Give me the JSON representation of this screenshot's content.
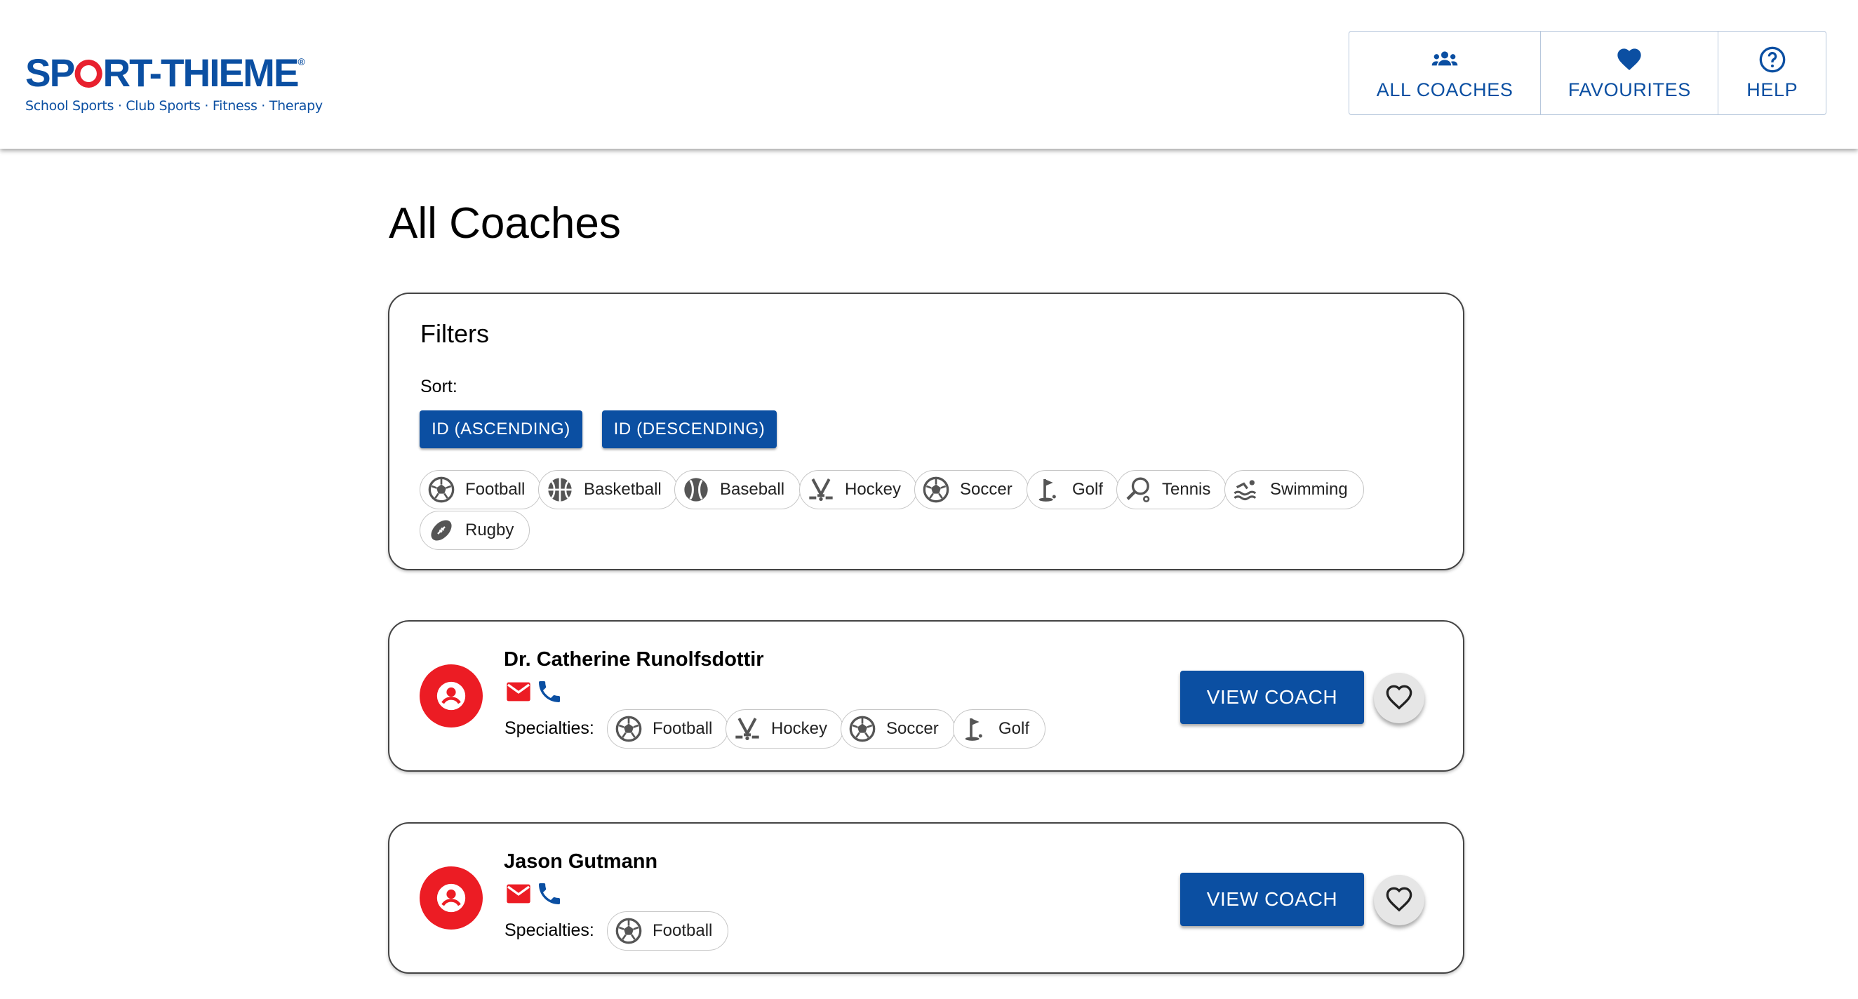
{
  "brand": {
    "logo_text_left": "SP",
    "logo_text_right": "RT-THIEME",
    "logo_reg": "®",
    "tagline": "School Sports · Club Sports · Fitness · Therapy",
    "primary_color": "#0b4fa2",
    "accent_color": "#e8202e"
  },
  "nav": {
    "all_coaches": {
      "label": "ALL COACHES",
      "icon": "group-icon"
    },
    "favourites": {
      "label": "FAVOURITES",
      "icon": "heart-icon"
    },
    "help": {
      "label": "HELP",
      "icon": "help-circle-icon"
    }
  },
  "page": {
    "title": "All Coaches"
  },
  "filters": {
    "title": "Filters",
    "sort_label": "Sort:",
    "sort_buttons": [
      "ID (ASCENDING)",
      "ID (DESCENDING)"
    ],
    "sports": [
      {
        "label": "Football",
        "icon": "soccer-ball-icon"
      },
      {
        "label": "Basketball",
        "icon": "basketball-icon"
      },
      {
        "label": "Baseball",
        "icon": "baseball-icon"
      },
      {
        "label": "Hockey",
        "icon": "hockey-icon"
      },
      {
        "label": "Soccer",
        "icon": "soccer-ball-icon"
      },
      {
        "label": "Golf",
        "icon": "golf-icon"
      },
      {
        "label": "Tennis",
        "icon": "tennis-icon"
      },
      {
        "label": "Swimming",
        "icon": "swimming-icon"
      },
      {
        "label": "Rugby",
        "icon": "rugby-ball-icon"
      }
    ]
  },
  "coaches": [
    {
      "name": "Dr. Catherine Runolfsdottir",
      "specialties_label": "Specialties:",
      "specialties": [
        "Football",
        "Hockey",
        "Soccer",
        "Golf"
      ],
      "view_label": "VIEW COACH"
    },
    {
      "name": "Jason Gutmann",
      "specialties_label": "Specialties:",
      "specialties": [
        "Football"
      ],
      "view_label": "VIEW COACH"
    }
  ],
  "colors": {
    "avatar_bg": "#ec1c24",
    "email_icon": "#ec1c24",
    "phone_icon": "#0b4fa2",
    "button_bg": "#0b4fa2"
  }
}
